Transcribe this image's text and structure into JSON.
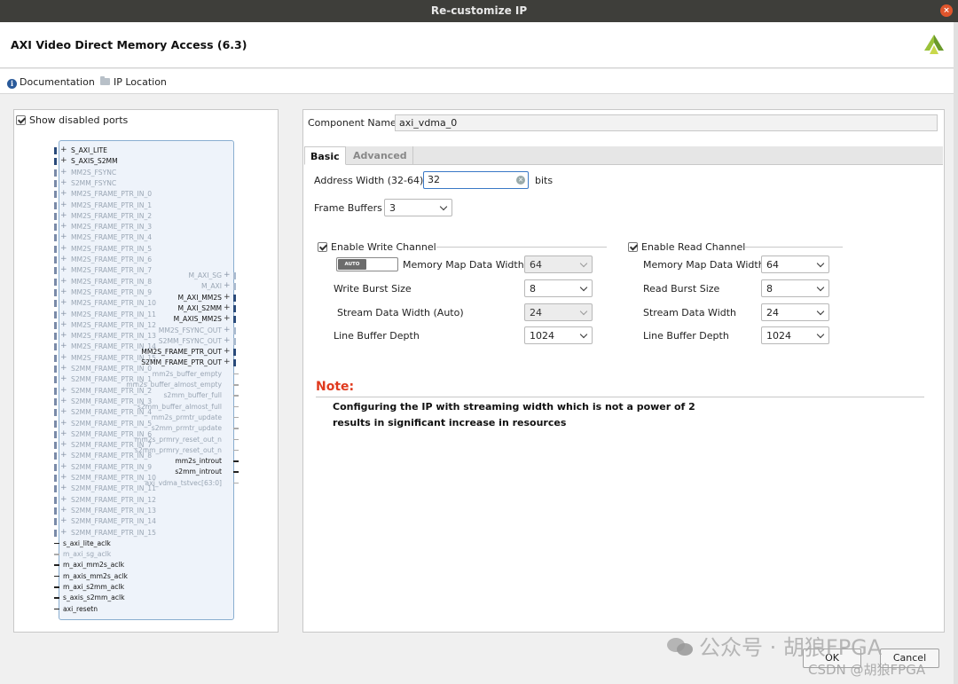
{
  "window": {
    "title": "Re-customize IP",
    "close_glyph": "×"
  },
  "header": {
    "title": "AXI Video Direct Memory Access (6.3)"
  },
  "links": {
    "documentation": "Documentation",
    "ip_location": "IP Location"
  },
  "left_panel": {
    "show_disabled_ports": "Show disabled ports",
    "ports_left": [
      {
        "label": "S_AXI_LITE",
        "enabled": true
      },
      {
        "label": "S_AXIS_S2MM",
        "enabled": true
      },
      {
        "label": "MM2S_FSYNC",
        "enabled": false
      },
      {
        "label": "S2MM_FSYNC",
        "enabled": false
      },
      {
        "label": "MM2S_FRAME_PTR_IN_0",
        "enabled": false
      },
      {
        "label": "MM2S_FRAME_PTR_IN_1",
        "enabled": false
      },
      {
        "label": "MM2S_FRAME_PTR_IN_2",
        "enabled": false
      },
      {
        "label": "MM2S_FRAME_PTR_IN_3",
        "enabled": false
      },
      {
        "label": "MM2S_FRAME_PTR_IN_4",
        "enabled": false
      },
      {
        "label": "MM2S_FRAME_PTR_IN_5",
        "enabled": false
      },
      {
        "label": "MM2S_FRAME_PTR_IN_6",
        "enabled": false
      },
      {
        "label": "MM2S_FRAME_PTR_IN_7",
        "enabled": false
      },
      {
        "label": "MM2S_FRAME_PTR_IN_8",
        "enabled": false
      },
      {
        "label": "MM2S_FRAME_PTR_IN_9",
        "enabled": false
      },
      {
        "label": "MM2S_FRAME_PTR_IN_10",
        "enabled": false
      },
      {
        "label": "MM2S_FRAME_PTR_IN_11",
        "enabled": false
      },
      {
        "label": "MM2S_FRAME_PTR_IN_12",
        "enabled": false
      },
      {
        "label": "MM2S_FRAME_PTR_IN_13",
        "enabled": false
      },
      {
        "label": "MM2S_FRAME_PTR_IN_14",
        "enabled": false
      },
      {
        "label": "MM2S_FRAME_PTR_IN_15",
        "enabled": false
      },
      {
        "label": "S2MM_FRAME_PTR_IN_0",
        "enabled": false
      },
      {
        "label": "S2MM_FRAME_PTR_IN_1",
        "enabled": false
      },
      {
        "label": "S2MM_FRAME_PTR_IN_2",
        "enabled": false
      },
      {
        "label": "S2MM_FRAME_PTR_IN_3",
        "enabled": false
      },
      {
        "label": "S2MM_FRAME_PTR_IN_4",
        "enabled": false
      },
      {
        "label": "S2MM_FRAME_PTR_IN_5",
        "enabled": false
      },
      {
        "label": "S2MM_FRAME_PTR_IN_6",
        "enabled": false
      },
      {
        "label": "S2MM_FRAME_PTR_IN_7",
        "enabled": false
      },
      {
        "label": "S2MM_FRAME_PTR_IN_8",
        "enabled": false
      },
      {
        "label": "S2MM_FRAME_PTR_IN_9",
        "enabled": false
      },
      {
        "label": "S2MM_FRAME_PTR_IN_10",
        "enabled": false
      },
      {
        "label": "S2MM_FRAME_PTR_IN_11",
        "enabled": false
      },
      {
        "label": "S2MM_FRAME_PTR_IN_12",
        "enabled": false
      },
      {
        "label": "S2MM_FRAME_PTR_IN_13",
        "enabled": false
      },
      {
        "label": "S2MM_FRAME_PTR_IN_14",
        "enabled": false
      },
      {
        "label": "S2MM_FRAME_PTR_IN_15",
        "enabled": false
      },
      {
        "label": "s_axi_lite_aclk",
        "enabled": true
      },
      {
        "label": "m_axi_sg_aclk",
        "enabled": false
      },
      {
        "label": "m_axi_mm2s_aclk",
        "enabled": true
      },
      {
        "label": "m_axis_mm2s_aclk",
        "enabled": true
      },
      {
        "label": "m_axi_s2mm_aclk",
        "enabled": true
      },
      {
        "label": "s_axis_s2mm_aclk",
        "enabled": true
      },
      {
        "label": "axi_resetn",
        "enabled": true
      }
    ],
    "ports_right": [
      {
        "label": "M_AXI_SG",
        "enabled": false
      },
      {
        "label": "M_AXI",
        "enabled": false
      },
      {
        "label": "M_AXI_MM2S",
        "enabled": true
      },
      {
        "label": "M_AXI_S2MM",
        "enabled": true
      },
      {
        "label": "M_AXIS_MM2S",
        "enabled": true
      },
      {
        "label": "MM2S_FSYNC_OUT",
        "enabled": false
      },
      {
        "label": "S2MM_FSYNC_OUT",
        "enabled": false
      },
      {
        "label": "MM2S_FRAME_PTR_OUT",
        "enabled": true
      },
      {
        "label": "S2MM_FRAME_PTR_OUT",
        "enabled": true
      },
      {
        "label": "mm2s_buffer_empty",
        "enabled": false
      },
      {
        "label": "mm2s_buffer_almost_empty",
        "enabled": false
      },
      {
        "label": "s2mm_buffer_full",
        "enabled": false
      },
      {
        "label": "s2mm_buffer_almost_full",
        "enabled": false
      },
      {
        "label": "mm2s_prmtr_update",
        "enabled": false
      },
      {
        "label": "s2mm_prmtr_update",
        "enabled": false
      },
      {
        "label": "mm2s_prmry_reset_out_n",
        "enabled": false
      },
      {
        "label": "s2mm_prmry_reset_out_n",
        "enabled": false
      },
      {
        "label": "mm2s_introut",
        "enabled": true
      },
      {
        "label": "s2mm_introut",
        "enabled": true
      },
      {
        "label": "axi_vdma_tstvec[63:0]",
        "enabled": false
      }
    ]
  },
  "component": {
    "label": "Component Name",
    "value": "axi_vdma_0"
  },
  "tabs": [
    {
      "label": "Basic",
      "active": true
    },
    {
      "label": "Advanced",
      "active": false
    }
  ],
  "basic": {
    "address_width": {
      "label": "Address Width (32-64)",
      "value": "32",
      "unit": "bits"
    },
    "frame_buffers": {
      "label": "Frame Buffers",
      "value": "3"
    },
    "write": {
      "label": "Enable Write Channel",
      "toggle_label": "AUTO",
      "memory_map_data_width": {
        "label": "Memory Map Data Width",
        "value": "64"
      },
      "write_burst_size": {
        "label": "Write Burst Size",
        "value": "8"
      },
      "stream_data_width": {
        "label": "Stream Data Width (Auto)",
        "value": "24"
      },
      "line_buffer_depth": {
        "label": "Line Buffer Depth",
        "value": "1024"
      }
    },
    "read": {
      "label": "Enable Read Channel",
      "memory_map_data_width": {
        "label": "Memory Map Data Width",
        "value": "64"
      },
      "read_burst_size": {
        "label": "Read Burst Size",
        "value": "8"
      },
      "stream_data_width": {
        "label": "Stream Data Width",
        "value": "24"
      },
      "line_buffer_depth": {
        "label": "Line Buffer Depth",
        "value": "1024"
      }
    },
    "note": {
      "title": "Note:",
      "line1": "Configuring the IP with streaming width which is not a power of 2",
      "line2": "results in significant increase in resources"
    }
  },
  "buttons": {
    "ok": "OK",
    "cancel": "Cancel"
  },
  "watermark": {
    "main": "公众号 · 胡狼FPGA",
    "sub": "CSDN @胡狼FPGA"
  },
  "colors": {
    "note": "#e03a1e",
    "accent": "#3a78c6",
    "ip_border": "#8aaed0"
  }
}
